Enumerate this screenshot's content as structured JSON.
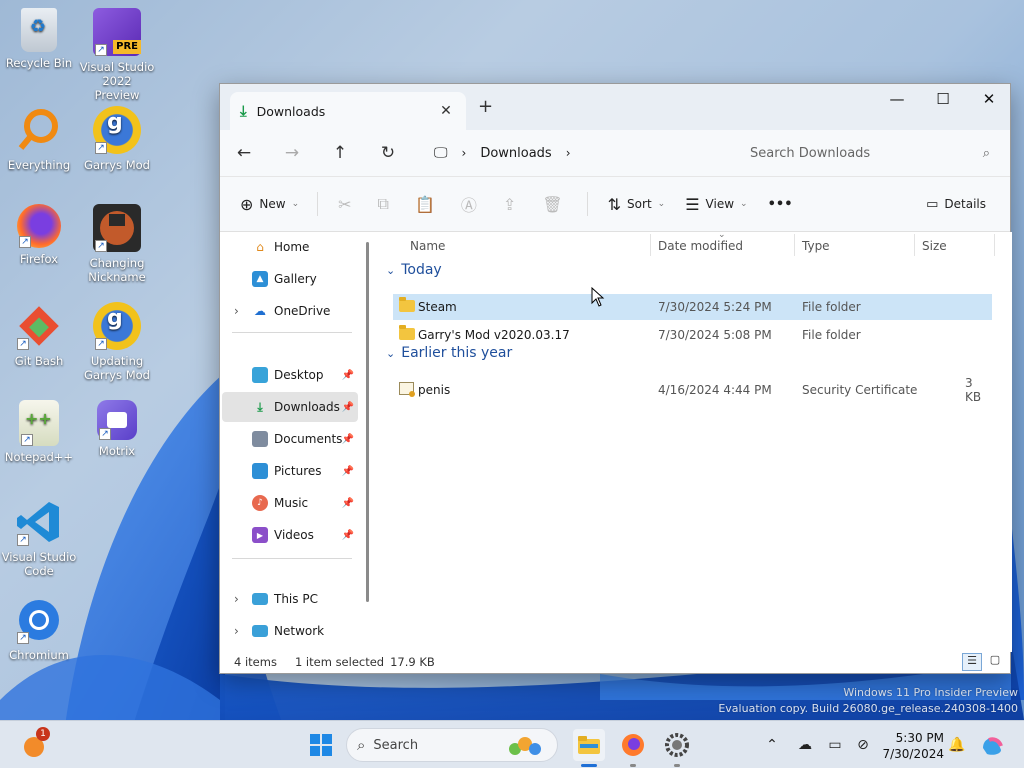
{
  "desktop": {
    "icons": [
      {
        "label": "Recycle Bin",
        "icon": "recycle-bin-icon"
      },
      {
        "label": "Visual Studio 2022 Preview",
        "icon": "visual-studio-icon",
        "badge": "PRE"
      },
      {
        "label": "Everything",
        "icon": "search-magnifier-icon"
      },
      {
        "label": "Garrys Mod",
        "icon": "garrys-mod-icon"
      },
      {
        "label": "Firefox",
        "icon": "firefox-icon"
      },
      {
        "label": "Changing Nickname",
        "icon": "tf2-icon"
      },
      {
        "label": "Git Bash",
        "icon": "git-bash-icon"
      },
      {
        "label": "Updating Garrys Mod",
        "icon": "garrys-mod-icon"
      },
      {
        "label": "Notepad++",
        "icon": "notepadpp-icon"
      },
      {
        "label": "Motrix",
        "icon": "motrix-icon"
      },
      {
        "label": "Visual Studio Code",
        "icon": "vscode-icon"
      },
      {
        "label": "Chromium",
        "icon": "chromium-icon"
      }
    ],
    "watermark": {
      "line1": "Windows 11 Pro Insider Preview",
      "line2": "Evaluation copy. Build 26080.ge_release.240308-1400"
    }
  },
  "explorer": {
    "tab_title": "Downloads",
    "address": {
      "crumb": "Downloads"
    },
    "search_placeholder": "Search Downloads",
    "toolbar": {
      "new": "New",
      "sort": "Sort",
      "view": "View",
      "more": "•••",
      "details": "Details"
    },
    "nav": [
      {
        "label": "Home"
      },
      {
        "label": "Gallery"
      },
      {
        "label": "OneDrive"
      },
      {
        "label": "Desktop"
      },
      {
        "label": "Downloads"
      },
      {
        "label": "Documents"
      },
      {
        "label": "Pictures"
      },
      {
        "label": "Music"
      },
      {
        "label": "Videos"
      },
      {
        "label": "This PC"
      },
      {
        "label": "Network"
      }
    ],
    "columns": {
      "name": "Name",
      "date": "Date modified",
      "type": "Type",
      "size": "Size"
    },
    "groups": [
      {
        "label": "Today"
      },
      {
        "label": "Earlier this year"
      }
    ],
    "files": [
      {
        "name": "Steam",
        "date": "7/30/2024 5:24 PM",
        "type": "File folder",
        "size": ""
      },
      {
        "name": "Garry's Mod v2020.03.17",
        "date": "7/30/2024 5:08 PM",
        "type": "File folder",
        "size": ""
      },
      {
        "name": "penis",
        "date": "4/16/2024 4:44 PM",
        "type": "Security Certificate",
        "size": "3 KB"
      }
    ],
    "status": {
      "count": "4 items",
      "selected": "1 item selected",
      "size": "17.9 KB"
    }
  },
  "taskbar": {
    "search": "Search",
    "time": "5:30 PM",
    "date": "7/30/2024",
    "update_badge": "1"
  }
}
